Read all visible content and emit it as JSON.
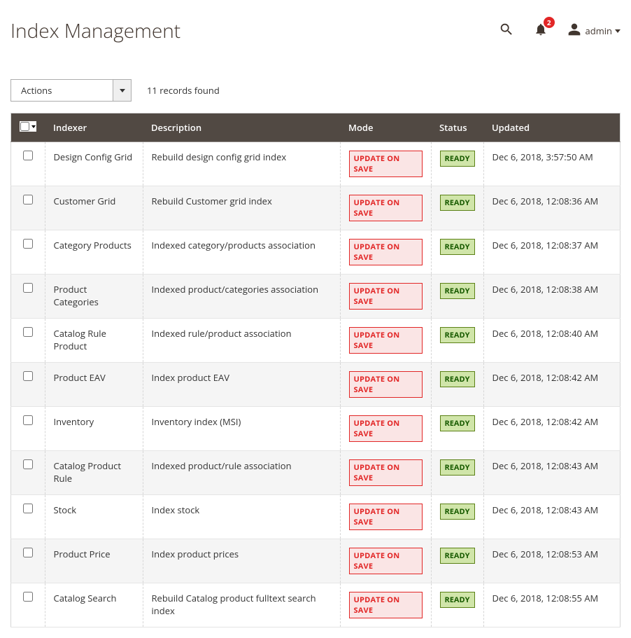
{
  "header": {
    "title": "Index Management",
    "notification_count": "2",
    "admin_label": "admin"
  },
  "toolbar": {
    "actions_label": "Actions",
    "records_found": "11 records found"
  },
  "columns": {
    "indexer": "Indexer",
    "description": "Description",
    "mode": "Mode",
    "status": "Status",
    "updated": "Updated"
  },
  "mode_label": "UPDATE ON SAVE",
  "status_label": "READY",
  "rows": [
    {
      "indexer": "Design Config Grid",
      "description": "Rebuild design config grid index",
      "updated": "Dec 6, 2018, 3:57:50 AM"
    },
    {
      "indexer": "Customer Grid",
      "description": "Rebuild Customer grid index",
      "updated": "Dec 6, 2018, 12:08:36 AM"
    },
    {
      "indexer": "Category Products",
      "description": "Indexed category/products association",
      "updated": "Dec 6, 2018, 12:08:37 AM"
    },
    {
      "indexer": "Product Categories",
      "description": "Indexed product/categories association",
      "updated": "Dec 6, 2018, 12:08:38 AM"
    },
    {
      "indexer": "Catalog Rule Product",
      "description": "Indexed rule/product association",
      "updated": "Dec 6, 2018, 12:08:40 AM"
    },
    {
      "indexer": "Product EAV",
      "description": "Index product EAV",
      "updated": "Dec 6, 2018, 12:08:42 AM"
    },
    {
      "indexer": "Inventory",
      "description": "Inventory index (MSI)",
      "updated": "Dec 6, 2018, 12:08:42 AM"
    },
    {
      "indexer": "Catalog Product Rule",
      "description": "Indexed product/rule association",
      "updated": "Dec 6, 2018, 12:08:43 AM"
    },
    {
      "indexer": "Stock",
      "description": "Index stock",
      "updated": "Dec 6, 2018, 12:08:43 AM"
    },
    {
      "indexer": "Product Price",
      "description": "Index product prices",
      "updated": "Dec 6, 2018, 12:08:53 AM"
    },
    {
      "indexer": "Catalog Search",
      "description": "Rebuild Catalog product fulltext search index",
      "updated": "Dec 6, 2018, 12:08:55 AM"
    }
  ]
}
